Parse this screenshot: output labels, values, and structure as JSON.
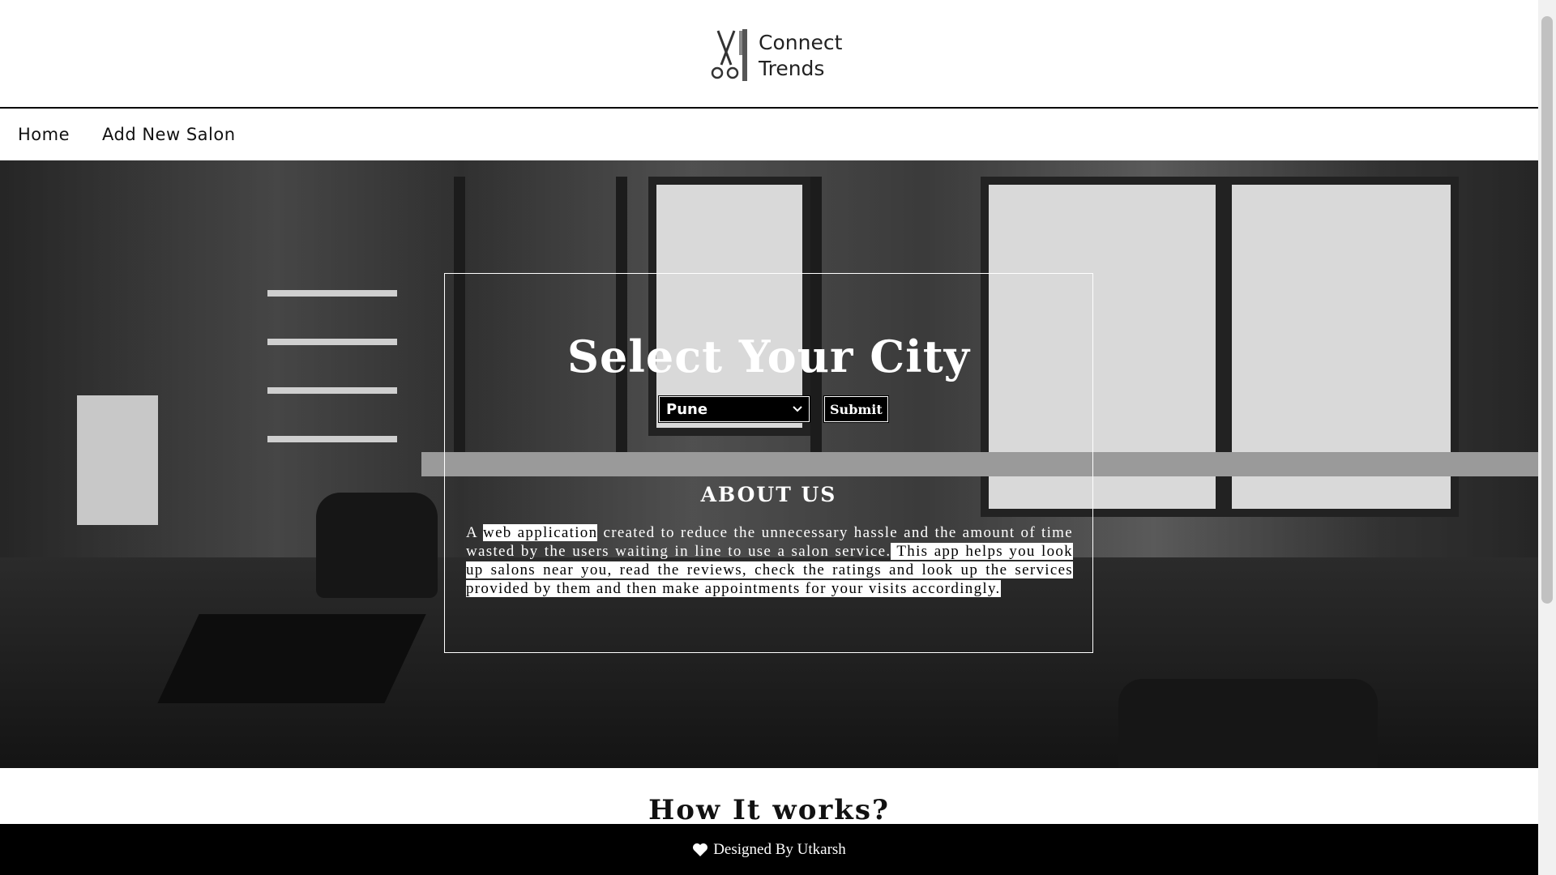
{
  "brand": {
    "line1": "Connect",
    "line2": "Trends",
    "logo_icon": "scissors-comb-icon"
  },
  "nav": {
    "home": "Home",
    "add_salon": "Add New Salon"
  },
  "hero": {
    "title": "Select Your City",
    "city_select": {
      "value": "Pune"
    },
    "submit_label": "Submit",
    "about_heading": "ABOUT US",
    "about_parts": {
      "p1": "A ",
      "p2": "web application",
      "p3": " created to reduce the unnecessary hassle and the amount of time wasted by the users waiting in line to use a salon service.",
      "p4": " This app helps you look up salons near you, read the reviews, check the ratings and look up the services provided by them and then make appointments for your visits accordingly."
    }
  },
  "how_it_works": "How It works?",
  "footer": {
    "text": "Designed By Utkarsh",
    "icon": "heart-icon"
  }
}
